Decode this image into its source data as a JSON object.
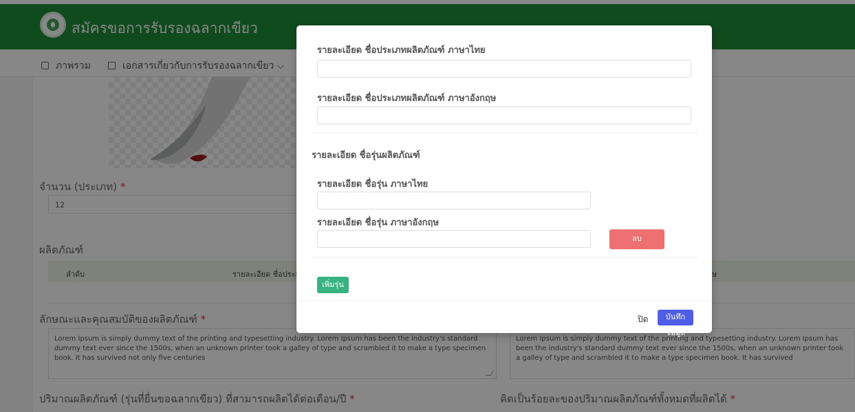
{
  "header": {
    "app_title": "สมัครขอการรับรองฉลากเขียว",
    "nav": [
      {
        "label": "ภาพรวม",
        "icon": "home-icon"
      },
      {
        "label": "เอกสารเกี่ยวกับการรับรองฉลากเขียว ⌵",
        "icon": "document-icon"
      }
    ]
  },
  "form": {
    "quantity_label": "จำนวน (ประเภท)",
    "quantity_value": "12",
    "products_label": "ผลิตภัณฑ์",
    "table_headers": [
      "ลำดับ",
      "รายละเอียด ชื่อประเภท",
      "ษ"
    ],
    "features_label": "ลักษณะและคุณสมบัติของผลิตภัณฑ์",
    "features_text_left": "Lorem Ipsum is simply dummy text of the printing and typesetting industry. Lorem Ipsum has been the industry's standard dummy text ever since the 1500s, when an unknown printer took a galley of type and scrambled it to make a type specimen book. It has survived not only five centuries",
    "features_text_right": "Lorem Ipsum is simply dummy text of the printing and typesetting industry. Lorem Ipsum has been the industry's standard dummy text ever since the 1500s, when an unknown printer took a galley of type and scrambled it to make a type specimen book. It has survived",
    "monthly_capacity_label": "ปริมาณผลิตภัณฑ์ (รุ่นที่ยื่นขอฉลากเขียว) ที่สามารถผลิตได้ต่อเดือน/ปี",
    "percent_label": "คิดเป็นร้อยละของปริมาณผลิตภัณฑ์ทั้งหมดที่ผลิตได้"
  },
  "modal": {
    "product_type_th_label": "รายละเอียด ชื่อประเภทผลิตภัณฑ์ ภาษาไทย",
    "product_type_en_label": "รายละเอียด ชื่อประเภทผลิตภัณฑ์ ภาษาอังกฤษ",
    "model_section_label": "รายละเอียด ชื่อรุ่นผลิตภัณฑ์",
    "model_th_label": "รายละเอียด ชื่อรุ่น ภาษาไทย",
    "model_en_label": "รายละเอียด ชื่อรุ่น ภาษาอังกฤษ",
    "delete_button": "ลบ",
    "add_model_button": "เพิ่มรุ่น",
    "close_button": "ปิด",
    "save_button": "บันทึกข้อมูล"
  },
  "colors": {
    "header_green": "#1f8f3a",
    "modal_backdrop": "rgba(0,0,0,0.47)",
    "save_blue": "#4f5fe5",
    "delete_red": "#ef7070",
    "add_green": "#36b37e"
  }
}
